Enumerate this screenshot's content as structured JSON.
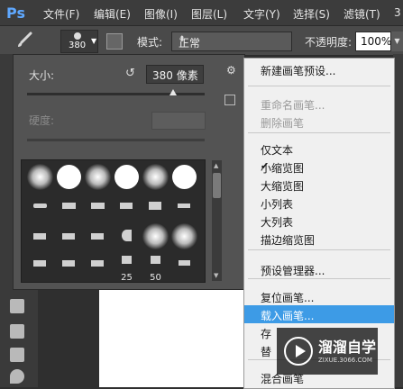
{
  "menubar": {
    "logo": "Ps",
    "items": [
      "文件(F)",
      "编辑(E)",
      "图像(I)",
      "图层(L)",
      "文字(Y)",
      "选择(S)",
      "滤镜(T)",
      "3"
    ]
  },
  "options": {
    "brush_size": "380",
    "mode_label": "模式:",
    "mode_value": "正常",
    "opacity_label": "不透明度:",
    "opacity_value": "100%"
  },
  "brush_panel": {
    "size_label": "大小:",
    "size_value": "380 像素",
    "size_level": 0.82,
    "hardness_label": "硬度:",
    "thumb_numbers": [
      "25",
      "50"
    ]
  },
  "dropdown": {
    "items": [
      {
        "label": "新建画笔预设...",
        "state": "normal"
      },
      {
        "label": "重命名画笔...",
        "state": "disabled"
      },
      {
        "label": "删除画笔",
        "state": "disabled"
      },
      {
        "label": "仅文本",
        "state": "normal"
      },
      {
        "label": "小缩览图",
        "state": "checked"
      },
      {
        "label": "大缩览图",
        "state": "normal"
      },
      {
        "label": "小列表",
        "state": "normal"
      },
      {
        "label": "大列表",
        "state": "normal"
      },
      {
        "label": "描边缩览图",
        "state": "normal"
      },
      {
        "label": "预设管理器...",
        "state": "normal"
      },
      {
        "label": "复位画笔...",
        "state": "normal"
      },
      {
        "label": "载入画笔...",
        "state": "active"
      },
      {
        "label": "存",
        "state": "normal"
      },
      {
        "label": "替",
        "state": "normal"
      },
      {
        "label": "混合画笔",
        "state": "normal"
      }
    ]
  },
  "watermark": {
    "title": "溜溜自学",
    "url": "ZIXUE.3066.COM"
  },
  "colors": {
    "accent": "#3d9be6",
    "logo": "#5fa8ff"
  }
}
